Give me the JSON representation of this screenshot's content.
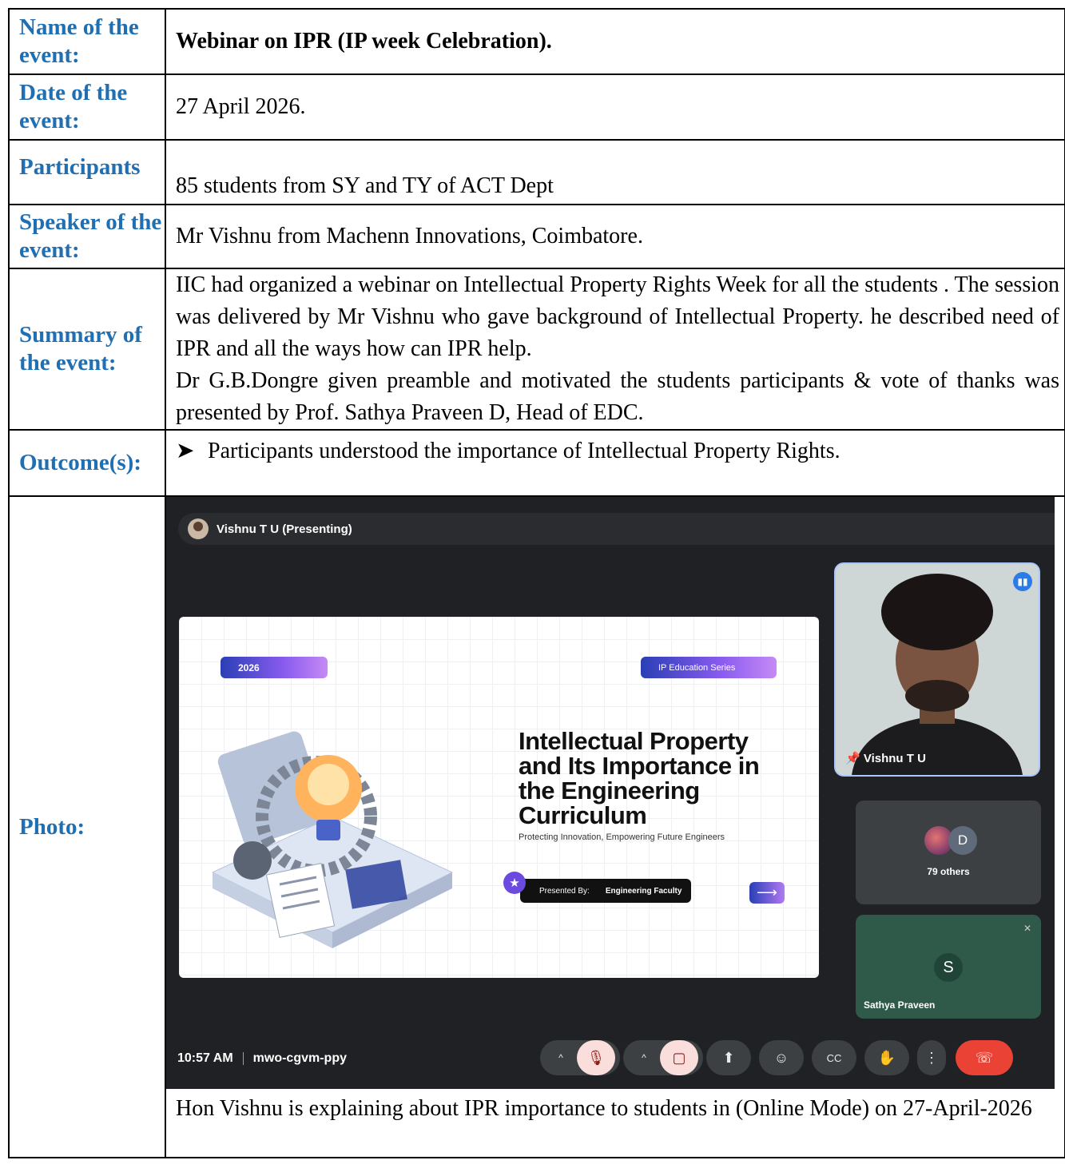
{
  "rows": {
    "name": {
      "label": "Name of the event:",
      "value": "Webinar on IPR (IP week Celebration)."
    },
    "date": {
      "label": "Date of the event:",
      "value": "27 April 2026."
    },
    "participants": {
      "label": "Participants",
      "value": "85 students from SY and TY of ACT Dept"
    },
    "speaker": {
      "label": "Speaker of the event:",
      "value": "Mr Vishnu from Machenn Innovations, Coimbatore."
    },
    "summary": {
      "label": "Summary of the event:",
      "para1": "IIC  had organized a webinar on Intellectual Property Rights Week for all the students . The session was delivered by Mr Vishnu who gave background of Intellectual Property. he described need of IPR and all the ways how can IPR help.",
      "para2": "Dr G.B.Dongre given preamble and motivated the students participants & vote of thanks was presented by Prof. Sathya Praveen D, Head of EDC."
    },
    "outcome": {
      "label": "Outcome(s):",
      "bullet": "Participants understood the importance of Intellectual Property Rights."
    },
    "photo": {
      "label": "Photo:",
      "caption": "Hon Vishnu is explaining about IPR importance to students  in (Online Mode) on 27-April-2026"
    }
  },
  "meet": {
    "presenter_banner": "Vishnu T U (Presenting)",
    "slide": {
      "year": "2026",
      "series": "IP Education Series",
      "title": "Intellectual Property and Its Importance in the Engineering Curriculum",
      "subtitle": "Protecting Innovation, Empowering Future Engineers",
      "presented_by_label": "Presented By:",
      "presented_by_value": "Engineering Faculty"
    },
    "main_tile_name": "Vishnu T U",
    "others_initial": "D",
    "others_label": "79 others",
    "sathya_initial": "S",
    "sathya_name": "Sathya Praveen",
    "time": "10:57 AM",
    "meeting_code": "mwo-cgvm-ppy",
    "icons": [
      "pin-icon",
      "mic-off-icon",
      "camera-off-icon",
      "present-icon",
      "emoji-icon",
      "captions-icon",
      "raise-hand-icon",
      "more-icon",
      "end-call-icon",
      "speaking-icon",
      "star-icon",
      "arrow-right-icon"
    ],
    "colors": {
      "label_blue": "#1f6fb2",
      "end_call": "#ea4335",
      "meet_bg": "#202124"
    }
  }
}
